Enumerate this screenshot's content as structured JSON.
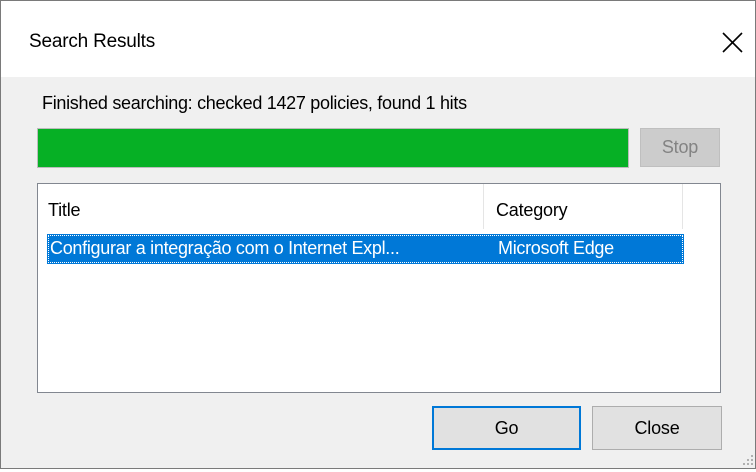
{
  "window": {
    "title": "Search Results",
    "close_icon": "close-icon"
  },
  "status": {
    "text": "Finished searching: checked 1427 policies, found 1 hits"
  },
  "progress": {
    "value_percent": 100,
    "color": "#06b025"
  },
  "buttons": {
    "stop_label": "Stop",
    "go_label": "Go",
    "close_label": "Close"
  },
  "results": {
    "columns": [
      "Title",
      "Category"
    ],
    "rows": [
      {
        "title": "Configurar a integração com o Internet Expl...",
        "category": "Microsoft Edge"
      }
    ]
  },
  "colors": {
    "selection": "#0078d7",
    "window_bg": "#f0f0f0",
    "default_button_border": "#0078d7"
  }
}
